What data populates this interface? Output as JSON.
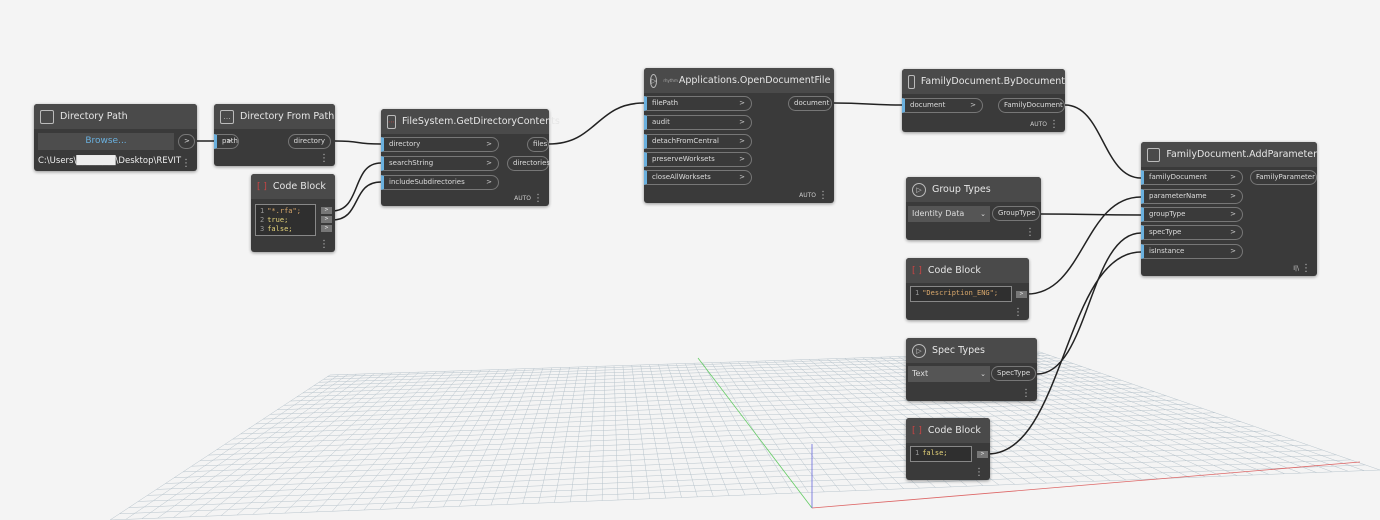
{
  "nodes": {
    "directory_path": {
      "title": "Directory Path",
      "button": "Browse...",
      "out": ">",
      "path": "C:\\Users\\██████\\Desktop\\REVIT"
    },
    "directory_from_path": {
      "title": "Directory From Path",
      "in": "path",
      "out": "directory"
    },
    "code_block_1": {
      "title": "Code Block",
      "lines": [
        "\"*.rfa\";",
        "true;",
        "false;"
      ],
      "line_nums": [
        "1",
        "2",
        "3"
      ]
    },
    "get_dir_contents": {
      "title": "FileSystem.GetDirectoryContents",
      "inputs": [
        "directory",
        "searchString",
        "includeSubdirectories"
      ],
      "outputs": [
        "files",
        "directories"
      ],
      "lacing": "AUTO"
    },
    "open_document": {
      "title": "Applications.OpenDocumentFile",
      "prefix": "rhythm",
      "inputs": [
        "filePath",
        "audit",
        "detachFromCentral",
        "preserveWorksets",
        "closeAllWorksets"
      ],
      "outputs": [
        "document"
      ],
      "lacing": "AUTO"
    },
    "by_document": {
      "title": "FamilyDocument.ByDocument",
      "inputs": [
        "document"
      ],
      "outputs": [
        "FamilyDocument"
      ],
      "lacing": "AUTO"
    },
    "add_parameter": {
      "title": "FamilyDocument.AddParameter",
      "inputs": [
        "familyDocument",
        "parameterName",
        "groupType",
        "specType",
        "isInstance"
      ],
      "outputs": [
        "FamilyParameter"
      ],
      "lacing": "I|\\"
    },
    "group_types": {
      "title": "Group Types",
      "selected": "Identity Data",
      "out": "GroupType"
    },
    "code_block_2": {
      "title": "Code Block",
      "line": "\"Description_ENG\";",
      "num": "1"
    },
    "spec_types": {
      "title": "Spec Types",
      "selected": "Text",
      "out": "SpecType"
    },
    "code_block_3": {
      "title": "Code Block",
      "line": "false;",
      "num": "1"
    }
  },
  "colors": {
    "port_accent": "#6ab0de",
    "node_bg": "#3a3a3a",
    "canvas": "#f4f4f4"
  }
}
